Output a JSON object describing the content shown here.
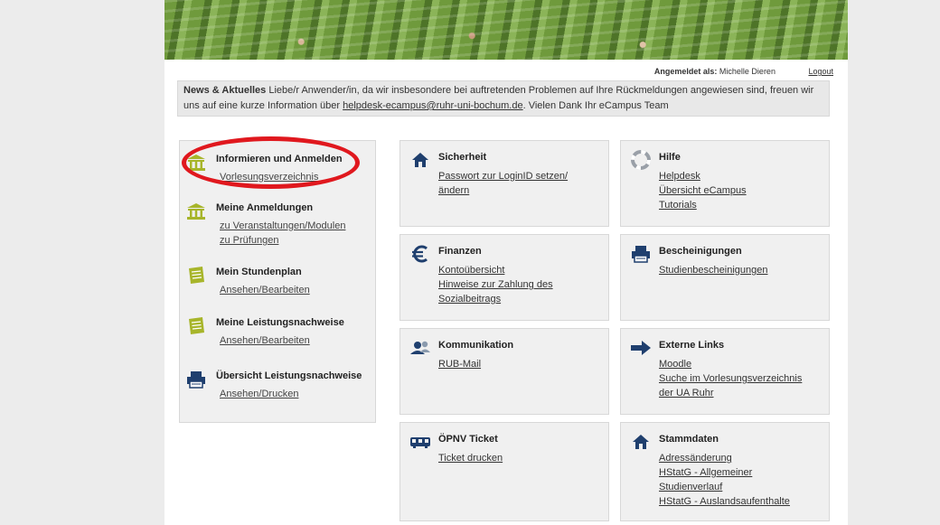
{
  "header": {
    "logged_in_label": "Angemeldet als:",
    "user_name": "Michelle Dieren",
    "logout_label": "Logout"
  },
  "news": {
    "heading": "News & Aktuelles",
    "text_1": "Liebe/r Anwender/in, da wir insbesondere bei auftretenden Problemen auf Ihre Rückmeldungen angewiesen sind, freuen wir uns auf eine kurze Information über",
    "link": "helpdesk-ecampus@ruhr-uni-bochum.de",
    "text_2": ". Vielen Dank Ihr eCampus Team"
  },
  "left_menu": [
    {
      "title": "Informieren und Anmelden",
      "icon": "building-icon",
      "links": [
        "Vorlesungsverzeichnis"
      ]
    },
    {
      "title": "Meine Anmeldungen",
      "icon": "building-icon",
      "links": [
        "zu Veranstaltungen/Modulen",
        "zu Prüfungen"
      ]
    },
    {
      "title": "Mein Stundenplan",
      "icon": "notepad-icon",
      "links": [
        "Ansehen/Bearbeiten"
      ]
    },
    {
      "title": "Meine Leistungsnachweise",
      "icon": "notepad-icon",
      "links": [
        "Ansehen/Bearbeiten"
      ]
    },
    {
      "title": "Übersicht Leistungsnachweise",
      "icon": "printer-icon",
      "links": [
        "Ansehen/Drucken"
      ]
    }
  ],
  "cards": {
    "sicherheit": {
      "title": "Sicherheit",
      "icon": "house-icon",
      "links": [
        "Passwort zur LoginID setzen/",
        "ändern"
      ]
    },
    "hilfe": {
      "title": "Hilfe",
      "icon": "lifebuoy-icon",
      "links": [
        "Helpdesk",
        "Übersicht eCampus",
        "Tutorials"
      ]
    },
    "finanzen": {
      "title": "Finanzen",
      "icon": "euro-icon",
      "links": [
        "Kontoübersicht",
        "Hinweise zur Zahlung des",
        "Sozialbeitrags"
      ]
    },
    "bescheinigungen": {
      "title": "Bescheinigungen",
      "icon": "printer-icon",
      "links": [
        "Studienbescheinigungen"
      ]
    },
    "kommunikation": {
      "title": "Kommunikation",
      "icon": "people-icon",
      "links": [
        "RUB-Mail"
      ]
    },
    "externe_links": {
      "title": "Externe Links",
      "icon": "arrow-right-icon",
      "links": [
        "Moodle",
        "Suche im Vorlesungsverzeichnis",
        "der UA Ruhr"
      ]
    },
    "oepnv": {
      "title": "ÖPNV Ticket",
      "icon": "tram-icon",
      "links": [
        "Ticket drucken"
      ]
    },
    "stammdaten": {
      "title": "Stammdaten",
      "icon": "house-icon",
      "links": [
        "Adressänderung",
        "HStatG - Allgemeiner",
        "Studienverlauf",
        "HStatG - Auslandsaufenthalte"
      ]
    }
  },
  "colors": {
    "icon_blue": "#1f3f6e",
    "icon_green": "#a7b52a",
    "annotation_red": "#e0181e",
    "panel_bg": "#f0f0f0"
  }
}
